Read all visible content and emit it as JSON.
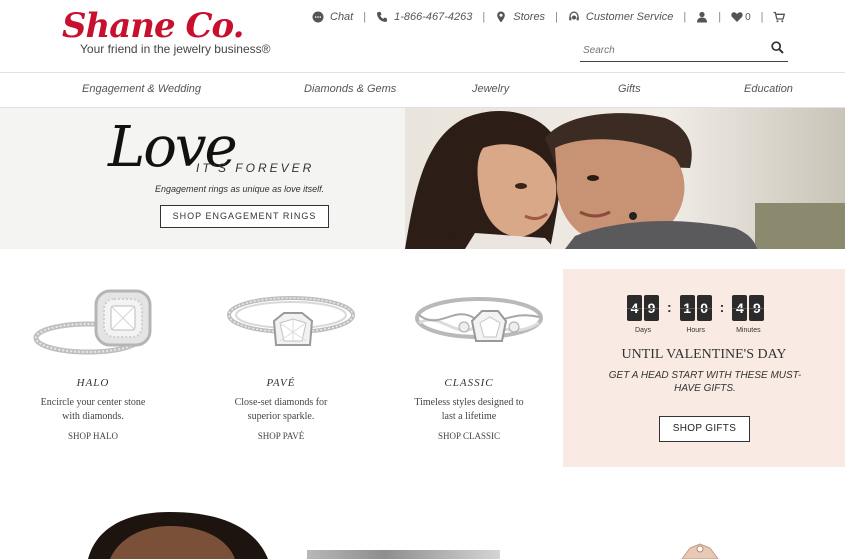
{
  "brand": {
    "name": "Shane Co.",
    "tagline": "Your friend in the jewelry business®",
    "color": "#c8102e"
  },
  "utility": {
    "chat": "Chat",
    "phone": "1-866-467-4263",
    "stores": "Stores",
    "customer_service": "Customer Service",
    "wishlist_count": "0"
  },
  "search": {
    "placeholder": "Search"
  },
  "nav": {
    "items": [
      "Engagement & Wedding",
      "Diamonds & Gems",
      "Jewelry",
      "Gifts",
      "Education"
    ]
  },
  "hero": {
    "script_word": "Love",
    "subtitle": "IT'S FOREVER",
    "tagline": "Engagement rings as unique as love itself.",
    "cta": "SHOP ENGAGEMENT RINGS"
  },
  "rings": [
    {
      "name": "HALO",
      "desc_line1": "Encircle your center stone",
      "desc_line2": "with diamonds.",
      "shop": "SHOP HALO"
    },
    {
      "name": "PAVÉ",
      "desc_line1": "Close-set diamonds for",
      "desc_line2": "superior sparkle.",
      "shop": "SHOP PAVÉ"
    },
    {
      "name": "CLASSIC",
      "desc_line1": "Timeless styles designed to",
      "desc_line2": "last a lifetime",
      "shop": "SHOP CLASSIC"
    }
  ],
  "promo": {
    "countdown": {
      "days": [
        "4",
        "9"
      ],
      "hours": [
        "1",
        "0"
      ],
      "minutes": [
        "4",
        "9"
      ],
      "days_label": "Days",
      "hours_label": "Hours",
      "minutes_label": "Minutes"
    },
    "title": "UNTIL VALENTINE'S DAY",
    "subtitle": "GET A HEAD START WITH THESE MUST-HAVE GIFTS.",
    "cta": "SHOP GIFTS",
    "background": "#faeae4"
  }
}
